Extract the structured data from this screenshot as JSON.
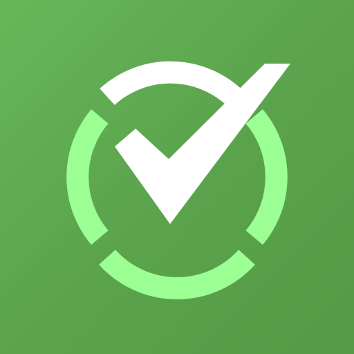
{
  "app_icon": {
    "name": "checkmark-app-icon",
    "icon": "check-circle-icon",
    "colors": {
      "background": "#5ea34e",
      "background_light": "#68b65a",
      "ring": "#9cff93",
      "check": "#ffffff"
    }
  }
}
